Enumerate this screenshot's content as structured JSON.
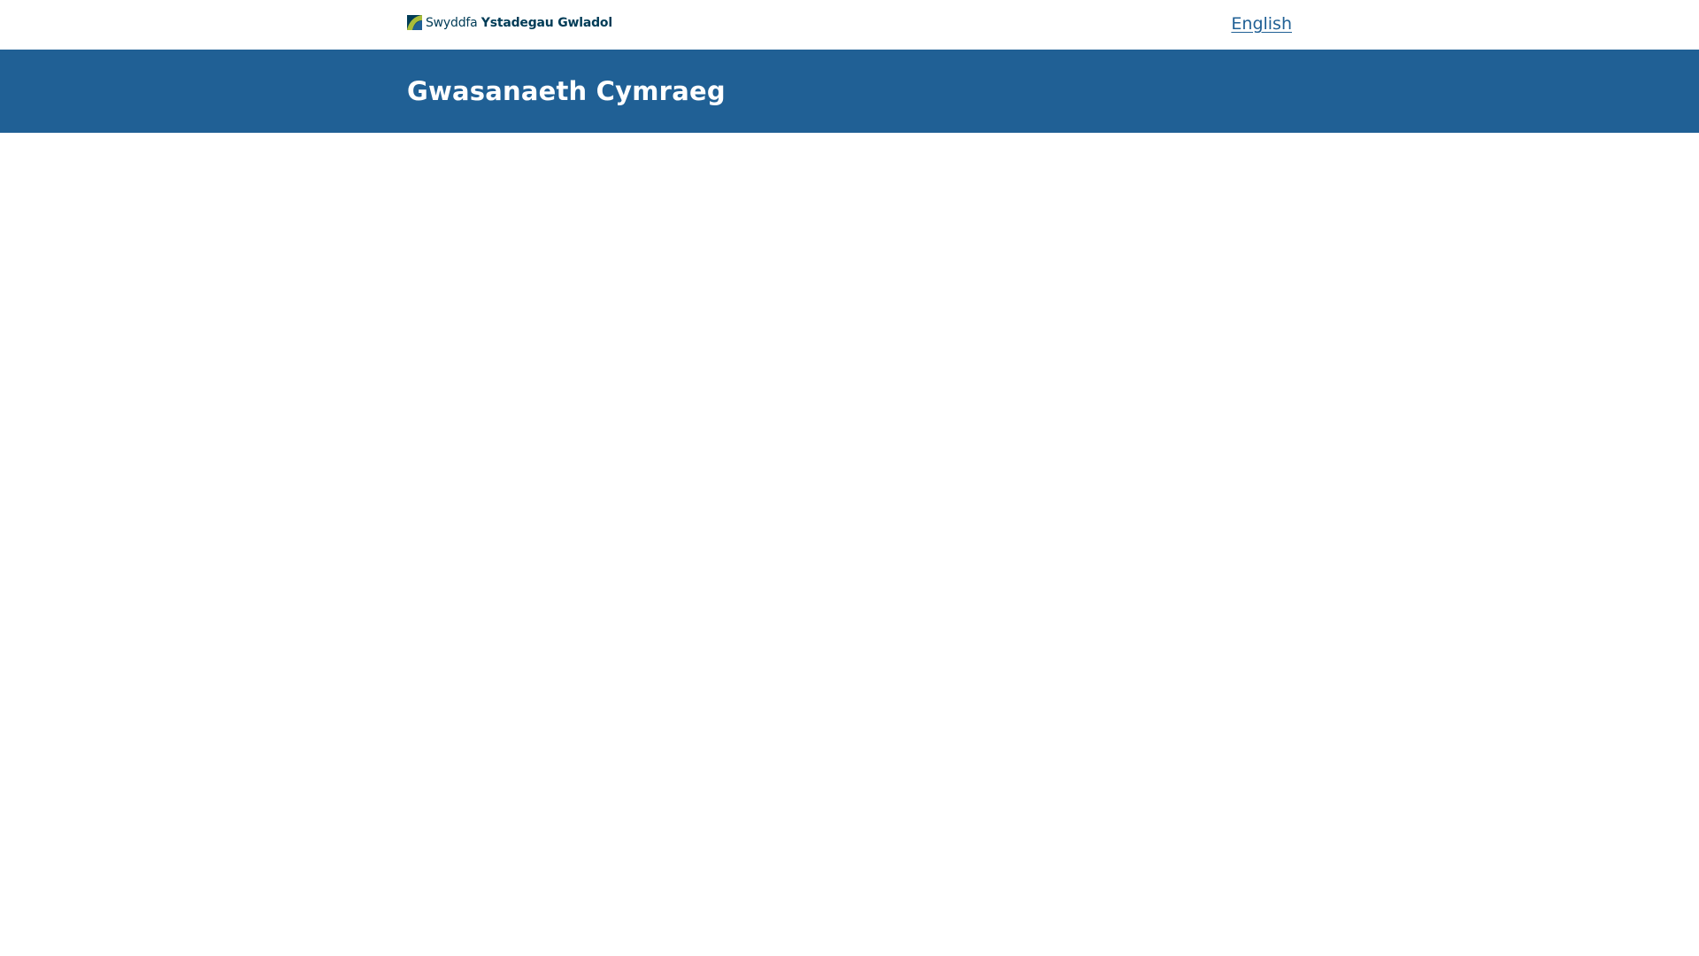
{
  "header": {
    "logo": {
      "icon": "ons-logo-mark-icon",
      "text_light": "Swyddfa",
      "text_bold": "Ystadegau Gwladol"
    },
    "language_link": "English"
  },
  "banner": {
    "title": "Gwasanaeth Cymraeg"
  },
  "colors": {
    "brand_blue": "#206095",
    "logo_navy": "#003c57",
    "logo_green": "#a8bd3a",
    "background": "#ffffff"
  }
}
